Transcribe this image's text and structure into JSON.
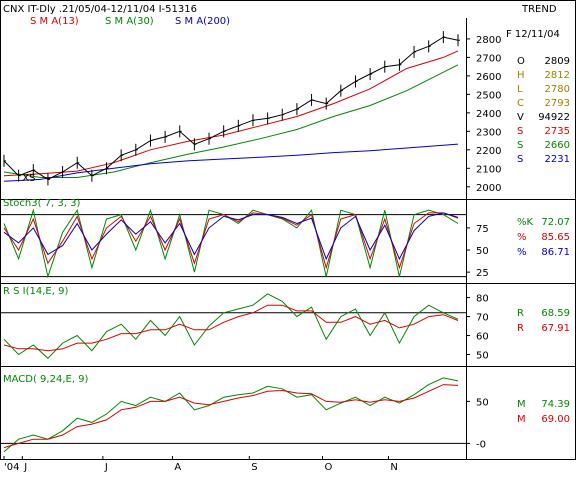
{
  "header": {
    "title": "CNX IT-Dly .21/05/04-12/11/04   I-51316",
    "trend_label": "TREND",
    "sma_legend": [
      {
        "label": "S M A(13)",
        "color": "#dd0000"
      },
      {
        "label": "S M A(30)",
        "color": "#008800"
      },
      {
        "label": "S M A(200)",
        "color": "#0000cc"
      }
    ]
  },
  "info_panel": {
    "date": "F 12/11/04",
    "rows": [
      {
        "key": "O",
        "value": "2809",
        "color": "#000000"
      },
      {
        "key": "H",
        "value": "2812",
        "color": "#a08000"
      },
      {
        "key": "L",
        "value": "2780",
        "color": "#a08000"
      },
      {
        "key": "C",
        "value": "2793",
        "color": "#a08000"
      },
      {
        "key": "V",
        "value": "94922",
        "color": "#000000"
      },
      {
        "key": "S",
        "value": "2735",
        "color": "#dd0000"
      },
      {
        "key": "S",
        "value": "2660",
        "color": "#008800"
      },
      {
        "key": "S",
        "value": "2231",
        "color": "#0000cc"
      }
    ]
  },
  "chart_data": [
    {
      "panel": "price",
      "type": "line",
      "ylim": [
        1950,
        2870
      ],
      "yticks": [
        2000,
        2100,
        2200,
        2300,
        2400,
        2500,
        2600,
        2700,
        2800
      ],
      "grid": false,
      "annotations": [
        "XS"
      ],
      "series": [
        {
          "name": "S M A(13)",
          "color": "#dd0000",
          "x": [
            0,
            10,
            20,
            30,
            40,
            50,
            60,
            70,
            80,
            90,
            100,
            110,
            120,
            124
          ],
          "values": [
            2060,
            2070,
            2085,
            2130,
            2200,
            2245,
            2280,
            2330,
            2380,
            2450,
            2530,
            2640,
            2700,
            2735
          ]
        },
        {
          "name": "S M A(30)",
          "color": "#008800",
          "x": [
            0,
            10,
            20,
            30,
            40,
            50,
            60,
            70,
            80,
            90,
            100,
            110,
            120,
            124
          ],
          "values": [
            2080,
            2050,
            2050,
            2080,
            2130,
            2175,
            2215,
            2260,
            2310,
            2380,
            2440,
            2520,
            2620,
            2660
          ]
        },
        {
          "name": "S M A(200)",
          "color": "#0000cc",
          "x": [
            0,
            10,
            20,
            30,
            40,
            50,
            60,
            70,
            80,
            90,
            100,
            110,
            120,
            124
          ],
          "values": [
            2030,
            2040,
            2075,
            2100,
            2125,
            2140,
            2150,
            2160,
            2170,
            2185,
            2195,
            2210,
            2225,
            2231
          ]
        },
        {
          "name": "Price",
          "color": "#000000",
          "x": [
            0,
            4,
            8,
            12,
            16,
            20,
            24,
            28,
            32,
            36,
            40,
            44,
            48,
            52,
            56,
            60,
            64,
            68,
            72,
            76,
            80,
            84,
            88,
            92,
            96,
            100,
            104,
            108,
            112,
            116,
            120,
            124
          ],
          "values": [
            2140,
            2060,
            2090,
            2040,
            2080,
            2130,
            2060,
            2100,
            2170,
            2200,
            2250,
            2270,
            2300,
            2230,
            2260,
            2300,
            2330,
            2360,
            2370,
            2390,
            2420,
            2470,
            2450,
            2520,
            2570,
            2610,
            2650,
            2660,
            2730,
            2760,
            2810,
            2793
          ]
        }
      ]
    },
    {
      "panel": "stochastic",
      "label": "Stoch3( 7, 3, 3)",
      "type": "line",
      "ylim": [
        15,
        102
      ],
      "yticks": [
        25,
        50,
        75
      ],
      "reference_lines": [
        20,
        90
      ],
      "series": [
        {
          "name": "%K",
          "color": "#008800",
          "x": [
            0,
            4,
            8,
            12,
            16,
            20,
            24,
            28,
            32,
            36,
            40,
            44,
            48,
            52,
            56,
            60,
            64,
            68,
            72,
            76,
            80,
            84,
            88,
            92,
            96,
            100,
            104,
            108,
            112,
            116,
            120,
            124
          ],
          "values": [
            80,
            40,
            95,
            20,
            70,
            95,
            30,
            85,
            90,
            50,
            95,
            40,
            90,
            25,
            95,
            90,
            80,
            95,
            90,
            85,
            75,
            95,
            20,
            95,
            90,
            30,
            95,
            20,
            90,
            95,
            90,
            80
          ],
          "display_value": "72.07"
        },
        {
          "name": "%",
          "color": "#dd0000",
          "x": [
            0,
            4,
            8,
            12,
            16,
            20,
            24,
            28,
            32,
            36,
            40,
            44,
            48,
            52,
            56,
            60,
            64,
            68,
            72,
            76,
            80,
            84,
            88,
            92,
            96,
            100,
            104,
            108,
            112,
            116,
            120,
            124
          ],
          "values": [
            75,
            50,
            85,
            35,
            60,
            88,
            40,
            75,
            88,
            60,
            88,
            50,
            85,
            35,
            85,
            90,
            82,
            92,
            90,
            86,
            78,
            90,
            30,
            85,
            90,
            40,
            85,
            30,
            80,
            92,
            92,
            86
          ],
          "display_value": "85.65"
        },
        {
          "name": "%",
          "color": "#0000cc",
          "x": [
            0,
            4,
            8,
            12,
            16,
            20,
            24,
            28,
            32,
            36,
            40,
            44,
            48,
            52,
            56,
            60,
            64,
            68,
            72,
            76,
            80,
            84,
            88,
            92,
            96,
            100,
            104,
            108,
            112,
            116,
            120,
            124
          ],
          "values": [
            70,
            58,
            75,
            45,
            55,
            80,
            50,
            68,
            84,
            68,
            82,
            58,
            80,
            45,
            75,
            88,
            84,
            90,
            90,
            87,
            80,
            86,
            40,
            75,
            88,
            50,
            78,
            40,
            72,
            88,
            92,
            87
          ],
          "display_value": "86.71"
        }
      ]
    },
    {
      "panel": "rsi",
      "label": "R S I(14,E, 9)",
      "type": "line",
      "ylim": [
        45,
        84
      ],
      "yticks": [
        50,
        60,
        70,
        80
      ],
      "reference_lines": [
        72
      ],
      "series": [
        {
          "name": "R",
          "color": "#008800",
          "x": [
            0,
            4,
            8,
            12,
            16,
            20,
            24,
            28,
            32,
            36,
            40,
            44,
            48,
            52,
            56,
            60,
            64,
            68,
            72,
            76,
            80,
            84,
            88,
            92,
            96,
            100,
            104,
            108,
            112,
            116,
            120,
            124
          ],
          "values": [
            58,
            50,
            55,
            48,
            56,
            60,
            52,
            62,
            66,
            58,
            68,
            60,
            70,
            55,
            65,
            72,
            74,
            76,
            82,
            78,
            70,
            75,
            58,
            70,
            74,
            60,
            72,
            56,
            70,
            76,
            72,
            68.59
          ],
          "display_value": "68.59"
        },
        {
          "name": "R",
          "color": "#dd0000",
          "x": [
            0,
            4,
            8,
            12,
            16,
            20,
            24,
            28,
            32,
            36,
            40,
            44,
            48,
            52,
            56,
            60,
            64,
            68,
            72,
            76,
            80,
            84,
            88,
            92,
            96,
            100,
            104,
            108,
            112,
            116,
            120,
            124
          ],
          "values": [
            55,
            53,
            53,
            52,
            53,
            56,
            56,
            58,
            61,
            61,
            63,
            63,
            66,
            63,
            63,
            67,
            70,
            72,
            76,
            76,
            73,
            73,
            67,
            67,
            70,
            66,
            68,
            64,
            66,
            70,
            71,
            67.91
          ],
          "display_value": "67.91"
        }
      ]
    },
    {
      "panel": "macd",
      "label": "MACD( 9,24,E, 9)",
      "type": "line",
      "ylim": [
        -15,
        85
      ],
      "yticks": [
        0,
        50
      ],
      "ytick_labels": [
        "-0",
        "50"
      ],
      "reference_lines": [
        0
      ],
      "series": [
        {
          "name": "M",
          "color": "#008800",
          "x": [
            0,
            4,
            8,
            12,
            16,
            20,
            24,
            28,
            32,
            36,
            40,
            44,
            48,
            52,
            56,
            60,
            64,
            68,
            72,
            76,
            80,
            84,
            88,
            92,
            96,
            100,
            104,
            108,
            112,
            116,
            120,
            124
          ],
          "values": [
            -10,
            5,
            10,
            5,
            15,
            30,
            25,
            35,
            50,
            45,
            55,
            50,
            60,
            40,
            45,
            55,
            58,
            60,
            68,
            65,
            55,
            58,
            40,
            48,
            55,
            45,
            55,
            48,
            58,
            70,
            78,
            74.39
          ],
          "display_value": "74.39"
        },
        {
          "name": "M",
          "color": "#dd0000",
          "x": [
            0,
            4,
            8,
            12,
            16,
            20,
            24,
            28,
            32,
            36,
            40,
            44,
            48,
            52,
            56,
            60,
            64,
            68,
            72,
            76,
            80,
            84,
            88,
            92,
            96,
            100,
            104,
            108,
            112,
            116,
            120,
            124
          ],
          "values": [
            -5,
            0,
            5,
            5,
            10,
            20,
            23,
            28,
            40,
            43,
            50,
            50,
            55,
            48,
            46,
            50,
            54,
            57,
            62,
            63,
            60,
            59,
            50,
            49,
            52,
            49,
            52,
            50,
            54,
            62,
            70,
            69.0
          ],
          "display_value": "69.00"
        }
      ]
    }
  ],
  "x_axis": {
    "labels": [
      "'04",
      "J",
      "J",
      "A",
      "S",
      "O",
      "N"
    ],
    "positions": [
      0,
      5,
      27,
      46,
      67,
      87,
      105
    ],
    "range": [
      0,
      124
    ]
  }
}
